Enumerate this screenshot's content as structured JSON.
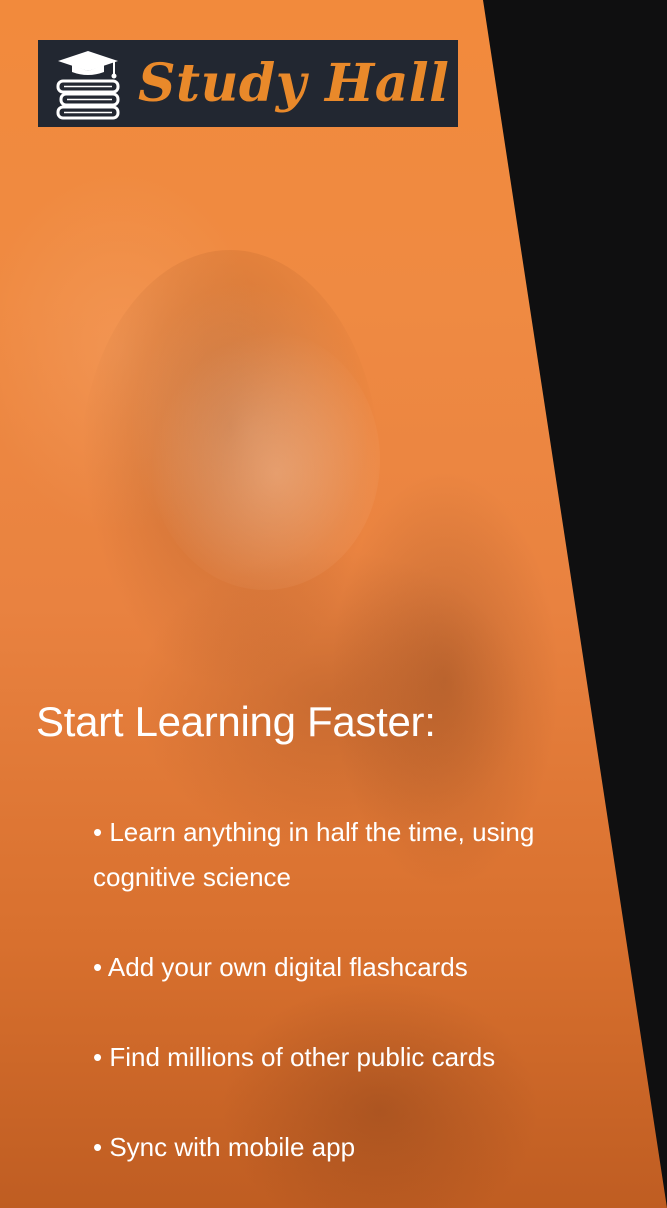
{
  "brand": {
    "name": "Study Hall",
    "icon": "graduation-cap-books-icon",
    "text_color": "#e9892a",
    "background_color": "#222731"
  },
  "hero": {
    "accent_color": "#ef8a42",
    "side_color": "#0f0f10",
    "headline": "Start Learning Faster:",
    "features": [
      {
        "bullet": "•",
        "text": "Learn anything in half the time, using cognitive science"
      },
      {
        "bullet": "•",
        "text": "Add your own digital flashcards"
      },
      {
        "bullet": "•",
        "text": "Find millions of other public cards"
      },
      {
        "bullet": "•",
        "text": "Sync with mobile app"
      }
    ]
  }
}
